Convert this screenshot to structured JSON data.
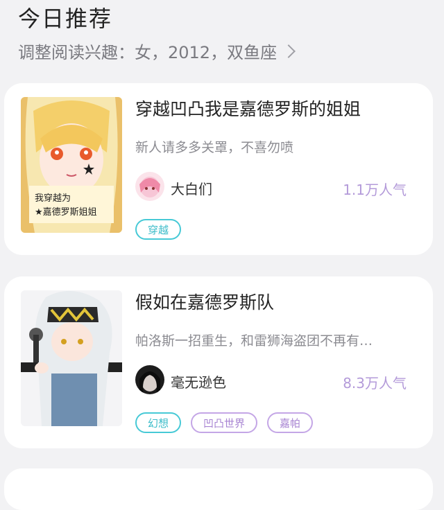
{
  "header": {
    "title": "今日推荐",
    "interest_text": "调整阅读兴趣：女，2012，双鱼座"
  },
  "books": [
    {
      "title": "穿越凹凸我是嘉德罗斯的姐姐",
      "description": "新人请多多关罩，不喜勿喷",
      "author": "大白们",
      "popularity": "1.1万人气",
      "cover_text": "我穿越为\n★嘉德罗斯姐姐",
      "tags": [
        "穿越"
      ]
    },
    {
      "title": "假如在嘉德罗斯队",
      "description": "帕洛斯一招重生，和雷狮海盗团不再有…",
      "author": "毫无逊色",
      "popularity": "8.3万人气",
      "tags": [
        "幻想",
        "凹凸世界",
        "嘉帕"
      ]
    }
  ],
  "colors": {
    "background": "#f2f2f4",
    "popularity": "#b39ad9",
    "tag_cyan": "#46c9d6",
    "tag_purple": "#c4a6e6"
  }
}
